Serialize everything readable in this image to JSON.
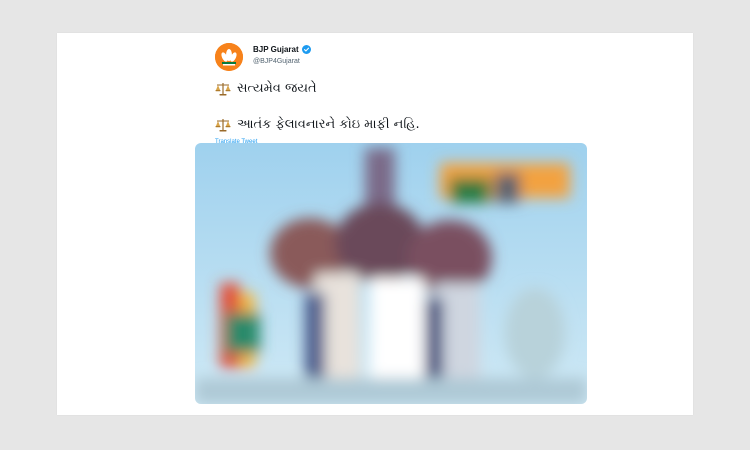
{
  "account": {
    "display_name": "BJP Gujarat",
    "handle": "@BJP4Gujarat",
    "verified": true,
    "avatar": "bjp-lotus-logo"
  },
  "tweet": {
    "line1": "સત્યમેવ જયતે",
    "line2": "આતંક ફેલાવનારને કોઇ માફી નહિ.",
    "emoji_icon": "balance-scale-icon",
    "translate_label": "Translate Tweet"
  },
  "media": {
    "description_visible": false,
    "blurred": true
  },
  "colors": {
    "background": "#e6e6e6",
    "card": "#ffffff",
    "avatar": "#f7821b",
    "verified": "#1d9bf0",
    "link": "#1d9bf0",
    "text": "#0f1419",
    "secondary": "#536471"
  }
}
